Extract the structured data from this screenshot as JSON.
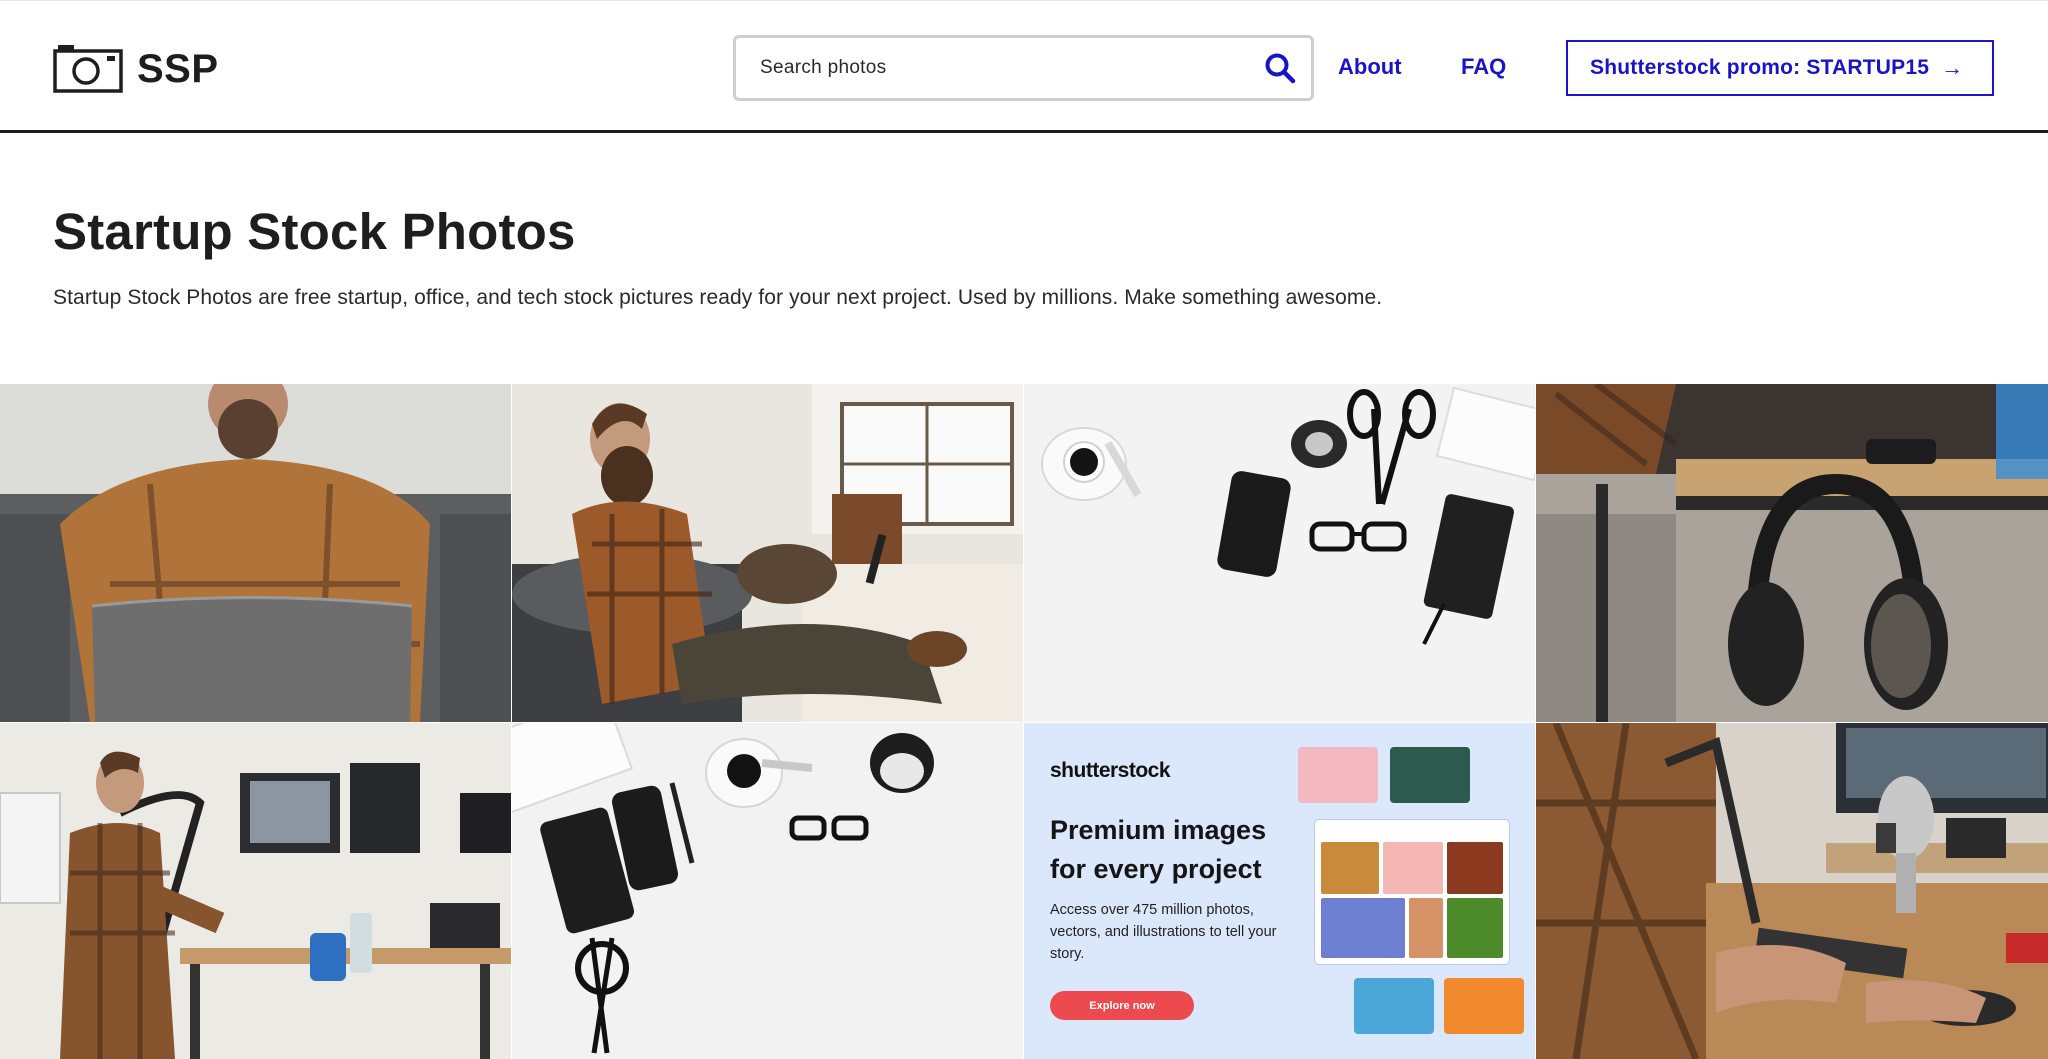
{
  "header": {
    "logo_text": "SSP",
    "search_placeholder": "Search photos",
    "nav": {
      "about": "About",
      "faq": "FAQ"
    },
    "promo_label": "Shutterstock promo: STARTUP15",
    "promo_arrow": "→"
  },
  "hero": {
    "title": "Startup Stock Photos",
    "description": "Startup Stock Photos are free startup, office, and tech stock pictures ready for your next project. Used by millions. Make something awesome."
  },
  "ad": {
    "brand": "shutterstock",
    "headline": "Premium images for every project",
    "body": "Access over 475 million photos, vectors, and illustrations to tell your story.",
    "button_label": "Explore now"
  },
  "colors": {
    "accent": "#1a14c9",
    "ad_background": "#dbe8fb",
    "ad_button": "#ec4a4f"
  },
  "icons": {
    "logo": "camera-icon",
    "search": "search-icon"
  }
}
